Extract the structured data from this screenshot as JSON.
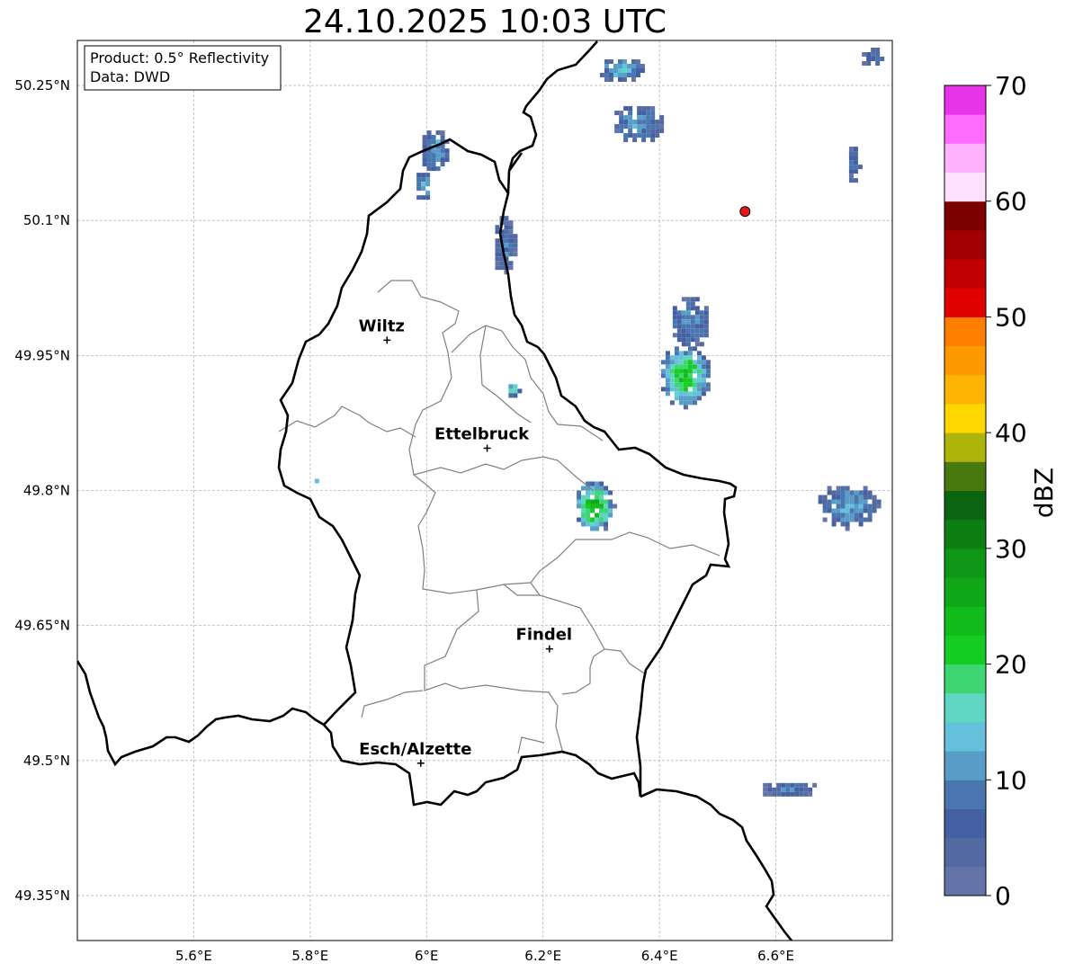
{
  "title": "24.10.2025 10:03 UTC",
  "info": {
    "product": "Product: 0.5° Reflectivity",
    "data": "Data: DWD"
  },
  "axes": {
    "lon_ticks": [
      {
        "value": 5.6,
        "label": "5.6°E"
      },
      {
        "value": 5.8,
        "label": "5.8°E"
      },
      {
        "value": 6.0,
        "label": "6°E"
      },
      {
        "value": 6.2,
        "label": "6.2°E"
      },
      {
        "value": 6.4,
        "label": "6.4°E"
      },
      {
        "value": 6.6,
        "label": "6.6°E"
      }
    ],
    "lat_ticks": [
      {
        "value": 50.25,
        "label": "50.25°N"
      },
      {
        "value": 50.1,
        "label": "50.1°N"
      },
      {
        "value": 49.95,
        "label": "49.95°N"
      },
      {
        "value": 49.8,
        "label": "49.8°N"
      },
      {
        "value": 49.65,
        "label": "49.65°N"
      },
      {
        "value": 49.5,
        "label": "49.5°N"
      },
      {
        "value": 49.35,
        "label": "49.35°N"
      }
    ],
    "lon_range": [
      5.4,
      6.8
    ],
    "lat_range": [
      49.3,
      50.3
    ],
    "grid": true
  },
  "cities": [
    {
      "name": "Wiltz",
      "lon": 5.932,
      "lat": 49.967
    },
    {
      "name": "Ettelbruck",
      "lon": 6.104,
      "lat": 49.847
    },
    {
      "name": "Findel",
      "lon": 6.211,
      "lat": 49.624
    },
    {
      "name": "Esch/Alzette",
      "lon": 5.99,
      "lat": 49.497
    }
  ],
  "radar_site": {
    "lon": 6.547,
    "lat": 50.11,
    "color": "#e31a1c"
  },
  "echoes": [
    {
      "lon": 6.01,
      "lat": 50.18,
      "rx": 0.025,
      "ry": 0.025,
      "dbz": 12
    },
    {
      "lon": 5.99,
      "lat": 50.14,
      "rx": 0.015,
      "ry": 0.018,
      "dbz": 14
    },
    {
      "lon": 6.13,
      "lat": 50.075,
      "rx": 0.02,
      "ry": 0.035,
      "dbz": 8
    },
    {
      "lon": 6.33,
      "lat": 50.27,
      "rx": 0.04,
      "ry": 0.014,
      "dbz": 14
    },
    {
      "lon": 6.36,
      "lat": 50.21,
      "rx": 0.045,
      "ry": 0.022,
      "dbz": 12
    },
    {
      "lon": 6.45,
      "lat": 49.99,
      "rx": 0.035,
      "ry": 0.03,
      "dbz": 10
    },
    {
      "lon": 6.44,
      "lat": 49.93,
      "rx": 0.045,
      "ry": 0.035,
      "dbz": 22
    },
    {
      "lon": 6.285,
      "lat": 49.785,
      "rx": 0.035,
      "ry": 0.03,
      "dbz": 24
    },
    {
      "lon": 6.72,
      "lat": 49.785,
      "rx": 0.055,
      "ry": 0.025,
      "dbz": 12
    },
    {
      "lon": 6.73,
      "lat": 50.165,
      "rx": 0.012,
      "ry": 0.022,
      "dbz": 8
    },
    {
      "lon": 6.76,
      "lat": 50.285,
      "rx": 0.02,
      "ry": 0.012,
      "dbz": 8
    },
    {
      "lon": 6.62,
      "lat": 49.47,
      "rx": 0.05,
      "ry": 0.01,
      "dbz": 8
    },
    {
      "lon": 6.145,
      "lat": 49.915,
      "rx": 0.012,
      "ry": 0.008,
      "dbz": 16
    },
    {
      "lon": 5.806,
      "lat": 49.812,
      "rx": 0.006,
      "ry": 0.006,
      "dbz": 16
    }
  ],
  "colorbar": {
    "label": "dBZ",
    "ticks": [
      0,
      10,
      20,
      30,
      40,
      50,
      60,
      70
    ],
    "range": [
      0,
      70
    ],
    "colors": [
      "#6474a8",
      "#526aa1",
      "#455fa3",
      "#4a76b0",
      "#5a9cc8",
      "#65c0dc",
      "#5fd6c4",
      "#3ed672",
      "#14cc22",
      "#12bb1c",
      "#10a818",
      "#0e9616",
      "#0c7e12",
      "#0b6510",
      "#48780e",
      "#adb40a",
      "#fed700",
      "#feb400",
      "#fe9a00",
      "#fe7e00",
      "#e00000",
      "#c00000",
      "#a00000",
      "#7c0000",
      "#ffe0ff",
      "#ffb3ff",
      "#ff6bff",
      "#e833e8"
    ]
  }
}
